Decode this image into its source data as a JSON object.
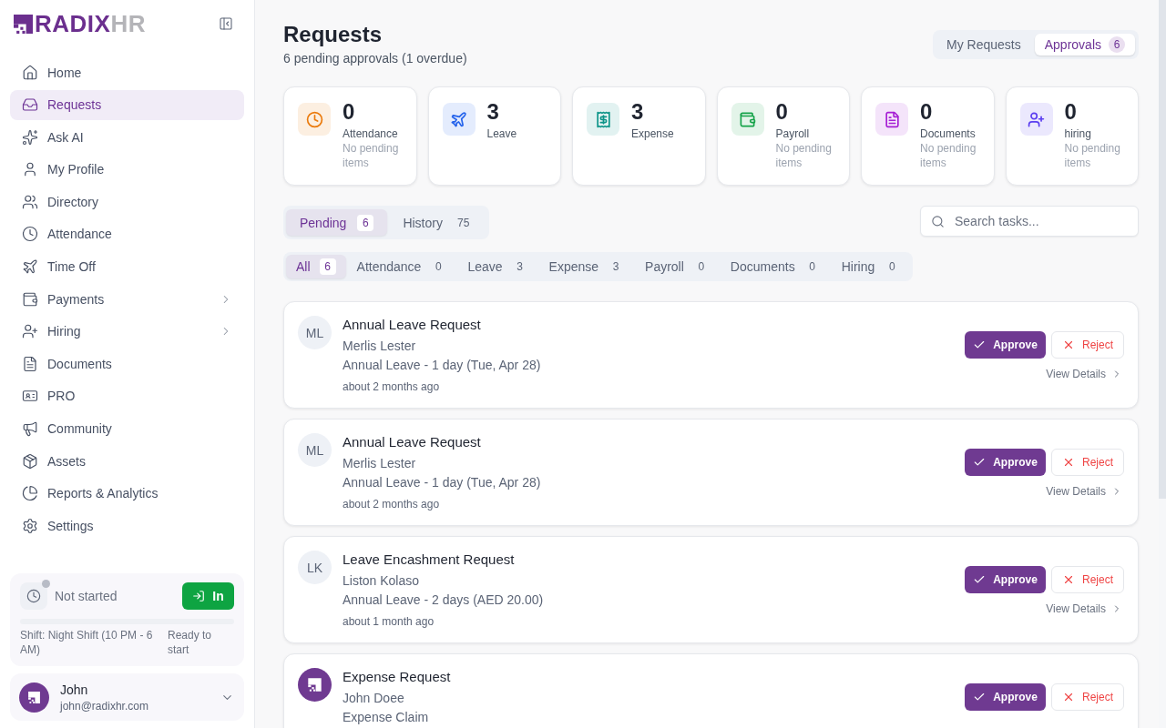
{
  "sidebar": {
    "logo": {
      "text": "RADIX",
      "accent": "HR"
    },
    "nav_items": [
      {
        "label": "Home",
        "kind": "link",
        "selected": false
      },
      {
        "label": "Requests",
        "kind": "link",
        "selected": true
      },
      {
        "label": "Ask AI",
        "kind": "link",
        "selected": false
      },
      {
        "label": "My Profile",
        "kind": "link",
        "selected": false
      },
      {
        "label": "Directory",
        "kind": "link",
        "selected": false
      },
      {
        "label": "Attendance",
        "kind": "link",
        "selected": false
      },
      {
        "label": "Time Off",
        "kind": "link",
        "selected": false
      },
      {
        "label": "Payments",
        "kind": "group",
        "selected": false
      },
      {
        "label": "Hiring",
        "kind": "group",
        "selected": false
      },
      {
        "label": "Documents",
        "kind": "link",
        "selected": false
      },
      {
        "label": "PRO",
        "kind": "link",
        "selected": false
      },
      {
        "label": "Community",
        "kind": "link",
        "selected": false
      },
      {
        "label": "Assets",
        "kind": "link",
        "selected": false
      },
      {
        "label": "Reports & Analytics",
        "kind": "link",
        "selected": false
      },
      {
        "label": "Settings",
        "kind": "link",
        "selected": false
      }
    ],
    "clock_widget": {
      "status": "Not started",
      "clocked_in": false,
      "button": "In",
      "level": 0,
      "shift": "Shift: Night Shift (10 PM - 6 AM)",
      "note": "Ready to start"
    },
    "user": {
      "name": "John",
      "email": "john@radixhr.com"
    }
  },
  "header": {
    "title": "Requests",
    "subtitle": "6 pending approvals (1 overdue)",
    "view_tabs": [
      {
        "label": "My Requests",
        "selected": false
      },
      {
        "label": "Approvals",
        "count": "6",
        "selected": true
      }
    ]
  },
  "stats": [
    {
      "kind": "attendance",
      "value": "0",
      "label": "Attendance",
      "note": "No pending items",
      "color": "#ea7a0c"
    },
    {
      "kind": "leave",
      "value": "3",
      "label": "Leave",
      "color": "#2563eb"
    },
    {
      "kind": "expense",
      "value": "3",
      "label": "Expense",
      "color": "#0d9488"
    },
    {
      "kind": "payroll",
      "value": "0",
      "label": "Payroll",
      "note": "No pending items",
      "color": "#16a34a"
    },
    {
      "kind": "documents",
      "value": "0",
      "label": "Documents",
      "note": "No pending items",
      "color": "#a61fd4"
    },
    {
      "kind": "hiring",
      "value": "0",
      "label": "hiring",
      "note": "No pending items",
      "color": "#5b3ef0"
    }
  ],
  "status_tabs": [
    {
      "label": "Pending",
      "count": "6",
      "selected": true
    },
    {
      "label": "History",
      "count": "75",
      "selected": false
    }
  ],
  "search": {
    "placeholder": "Search tasks..."
  },
  "filter_tabs": [
    {
      "label": "All",
      "count": "6",
      "selected": true
    },
    {
      "label": "Attendance",
      "count": "0",
      "selected": false
    },
    {
      "label": "Leave",
      "count": "3",
      "selected": false
    },
    {
      "label": "Expense",
      "count": "3",
      "selected": false
    },
    {
      "label": "Payroll",
      "count": "0",
      "selected": false
    },
    {
      "label": "Documents",
      "count": "0",
      "selected": false
    },
    {
      "label": "Hiring",
      "count": "0",
      "selected": false
    }
  ],
  "requests": [
    {
      "avatar": {
        "kind": "initials",
        "initials": "ML"
      },
      "title": "Annual Leave Request",
      "requester": "Merlis Lester",
      "detail": "Annual Leave - 1 day (Tue, Apr 28)",
      "time": "about 2 months ago",
      "approve": "Approve",
      "reject": "Reject",
      "details_link": "View Details"
    },
    {
      "avatar": {
        "kind": "initials",
        "initials": "ML"
      },
      "title": "Annual Leave Request",
      "requester": "Merlis Lester",
      "detail": "Annual Leave - 1 day (Tue, Apr 28)",
      "time": "about 2 months ago",
      "approve": "Approve",
      "reject": "Reject",
      "details_link": "View Details"
    },
    {
      "avatar": {
        "kind": "initials",
        "initials": "LK"
      },
      "title": "Leave Encashment Request",
      "requester": "Liston Kolaso",
      "detail": "Annual Leave - 2 days (AED 20.00)",
      "time": "about 1 month ago",
      "approve": "Approve",
      "reject": "Reject",
      "details_link": "View Details"
    },
    {
      "avatar": {
        "kind": "logo"
      },
      "title": "Expense Request",
      "requester": "John Doee",
      "detail": "Expense Claim",
      "approve": "Approve",
      "reject": "Reject"
    }
  ]
}
